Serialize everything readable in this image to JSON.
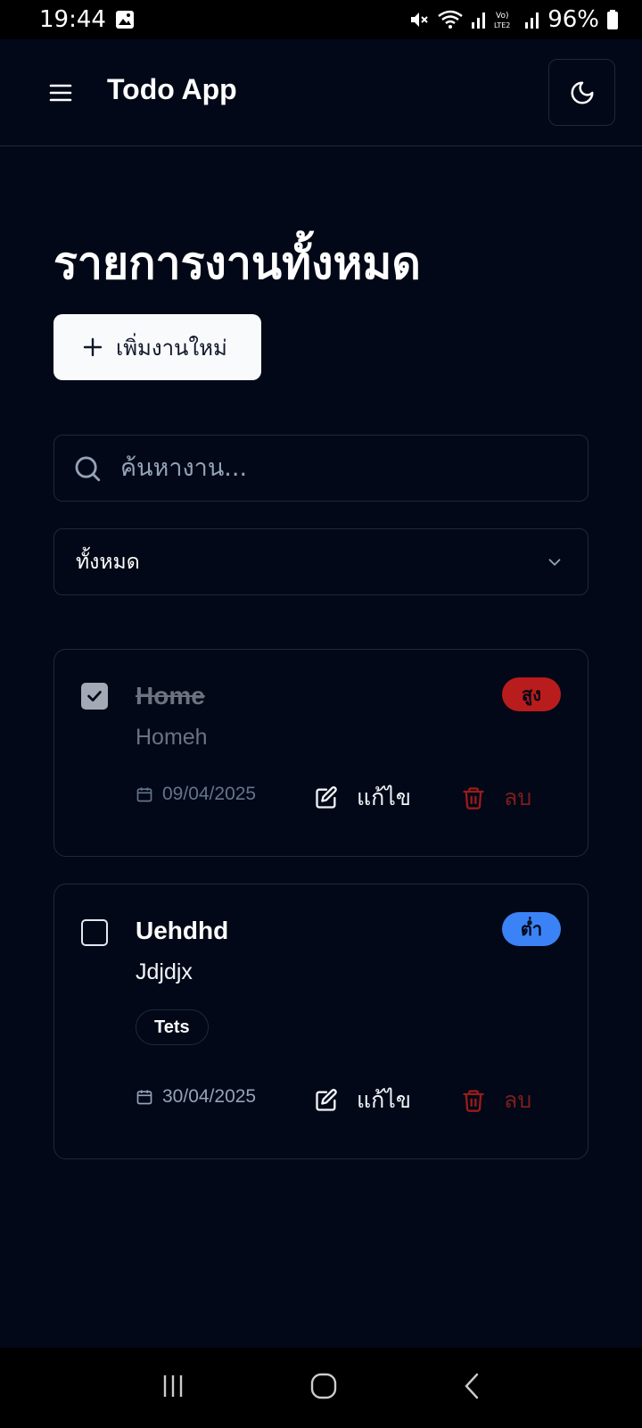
{
  "status_bar": {
    "time": "19:44",
    "battery": "96%",
    "icons": [
      "image-icon",
      "mute-icon",
      "wifi-icon",
      "signal-icon",
      "volte-icon",
      "battery-icon"
    ]
  },
  "header": {
    "title": "Todo App",
    "menu_icon": "menu-icon",
    "theme_icon": "moon-icon"
  },
  "main": {
    "page_title": "รายการงานทั้งหมด",
    "add_button_label": "เพิ่มงานใหม่",
    "search_placeholder": "ค้นหางาน...",
    "filter_selected": "ทั้งหมด"
  },
  "tasks": [
    {
      "title": "Home",
      "description": "Homeh",
      "completed": true,
      "priority": "สูง",
      "priority_color": "#b91c1c",
      "date": "09/04/2025",
      "tags": [],
      "edit_label": "แก้ไข",
      "delete_label": "ลบ"
    },
    {
      "title": "Uehdhd",
      "description": "Jdjdjx",
      "completed": false,
      "priority": "ต่ำ",
      "priority_color": "#3b82f6",
      "date": "30/04/2025",
      "tags": [
        "Tets"
      ],
      "edit_label": "แก้ไข",
      "delete_label": "ลบ"
    }
  ],
  "colors": {
    "background": "#020817",
    "border": "#1e293b",
    "danger": "#7f1d1d"
  }
}
